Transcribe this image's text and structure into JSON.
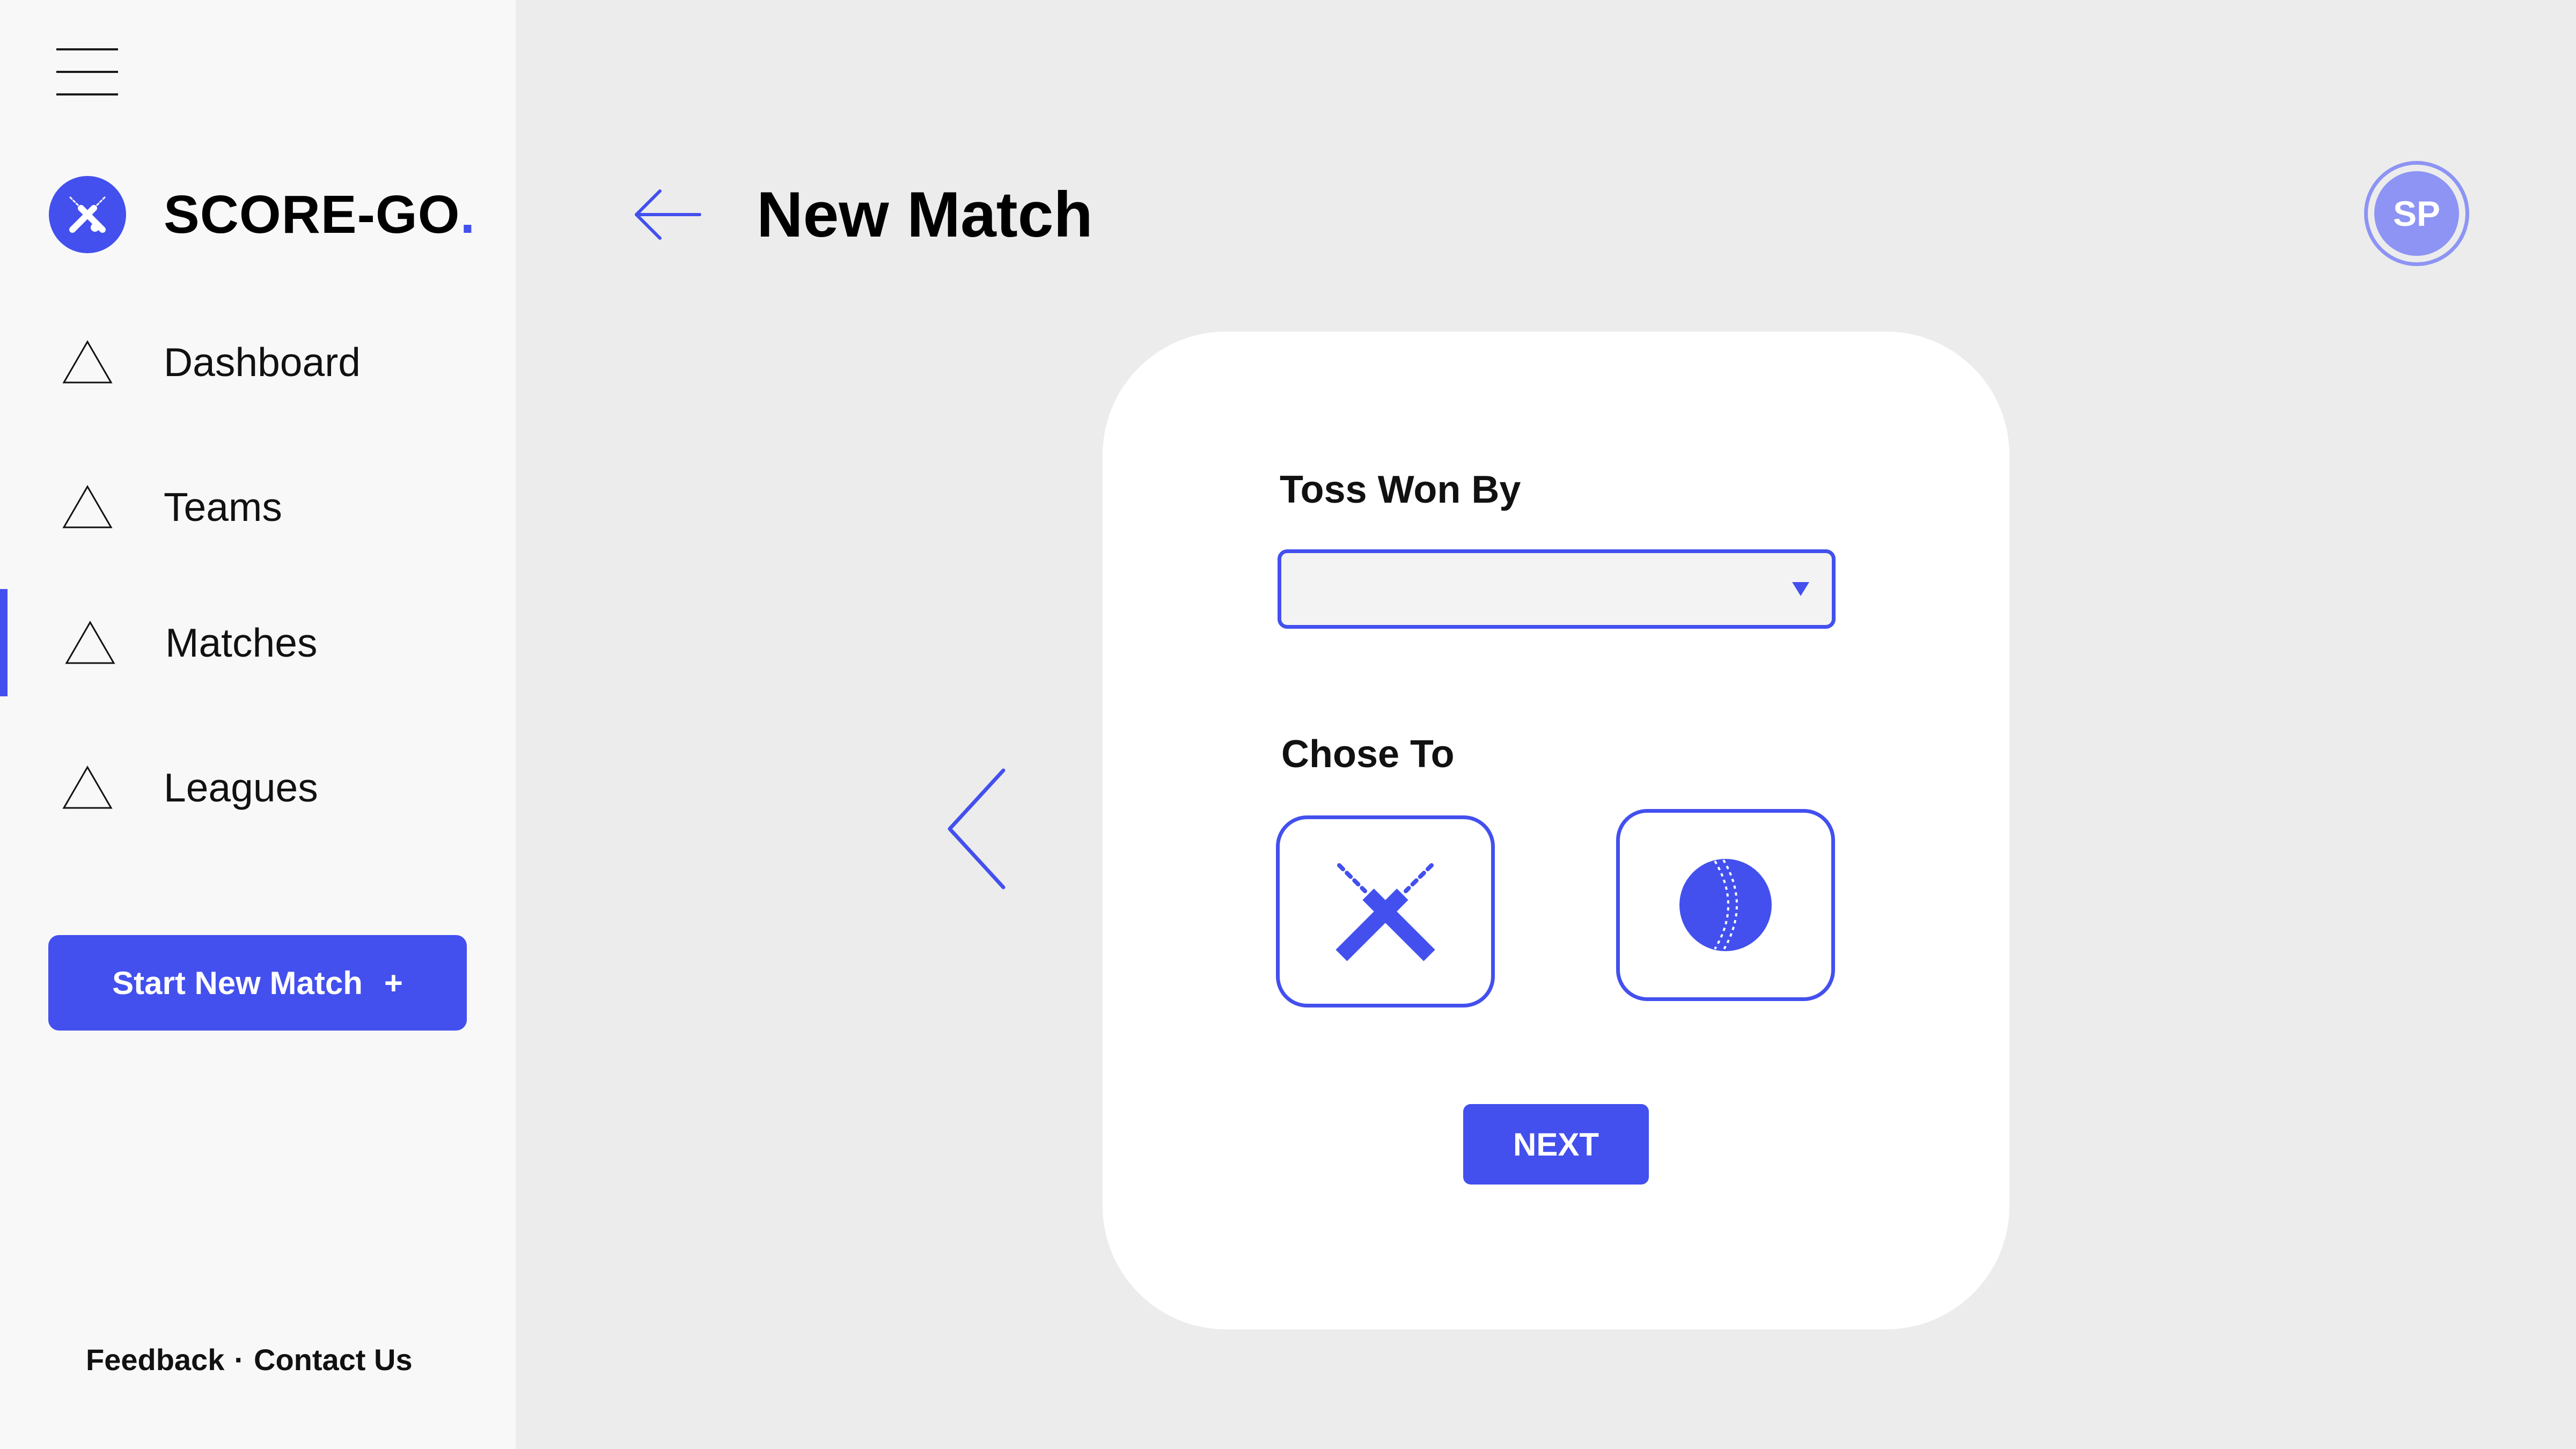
{
  "colors": {
    "accent": "#4350ee",
    "avatar": "#8d94f4",
    "background": "#ececec",
    "sidebar": "#f8f8f8",
    "card": "#ffffff"
  },
  "sidebar": {
    "menu_icon": "hamburger-menu-icon",
    "brand": {
      "logo_icon": "cricket-bats-icon",
      "name": "SCORE-GO",
      "dot": "."
    },
    "nav": [
      {
        "label": "Dashboard",
        "icon": "triangle-icon",
        "active": false
      },
      {
        "label": "Teams",
        "icon": "triangle-icon",
        "active": false
      },
      {
        "label": "Matches",
        "icon": "triangle-icon",
        "active": true
      },
      {
        "label": "Leagues",
        "icon": "triangle-icon",
        "active": false
      }
    ],
    "start_button": {
      "label": "Start New Match",
      "icon": "+"
    },
    "footer": {
      "feedback": "Feedback",
      "separator": "·",
      "contact": "Contact Us"
    }
  },
  "header": {
    "back_icon": "arrow-left-icon",
    "title": "New Match",
    "avatar_initials": "SP"
  },
  "carousel": {
    "prev_icon": "chevron-left-icon"
  },
  "form": {
    "toss_label": "Toss Won By",
    "toss_select": {
      "value": "",
      "arrow_icon": "triangle-down-icon"
    },
    "choice_label": "Chose To",
    "choices": [
      {
        "id": "bat",
        "icon": "crossed-bats-icon"
      },
      {
        "id": "bowl",
        "icon": "cricket-ball-icon"
      }
    ],
    "next_label": "NEXT"
  }
}
